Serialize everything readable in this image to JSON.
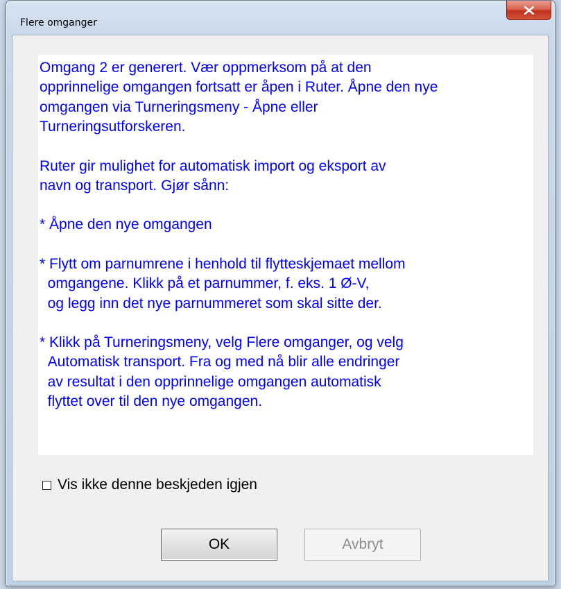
{
  "window": {
    "title": "Flere omganger",
    "close_label": "X"
  },
  "message": {
    "paragraphs": [
      "Omgang 2 er generert. Vær oppmerksom på at den\nopprinnelige omgangen fortsatt er åpen i Ruter. Åpne den nye\nomgangen via Turneringsmeny - Åpne eller\nTurneringsutforskeren.",
      "Ruter gir mulighet for automatisk import og eksport av\nnavn og transport. Gjør sånn:",
      "* Åpne den nye omgangen",
      "* Flytt om parnumrene i henhold til flytteskjemaet mellom\n  omgangene. Klikk på et parnummer, f. eks. 1 Ø-V,\n  og legg inn det nye parnummeret som skal sitte der.",
      "* Klikk på Turneringsmeny, velg Flere omganger, og velg\n  Automatisk transport. Fra og med nå blir alle endringer\n  av resultat i den opprinnelige omgangen automatisk\n  flyttet over til den nye omgangen."
    ],
    "text_color": "#0000ff"
  },
  "checkbox": {
    "label": "Vis ikke denne beskjeden igjen",
    "checked": false
  },
  "buttons": {
    "ok_label": "OK",
    "cancel_label": "Avbryt",
    "cancel_disabled": true
  }
}
